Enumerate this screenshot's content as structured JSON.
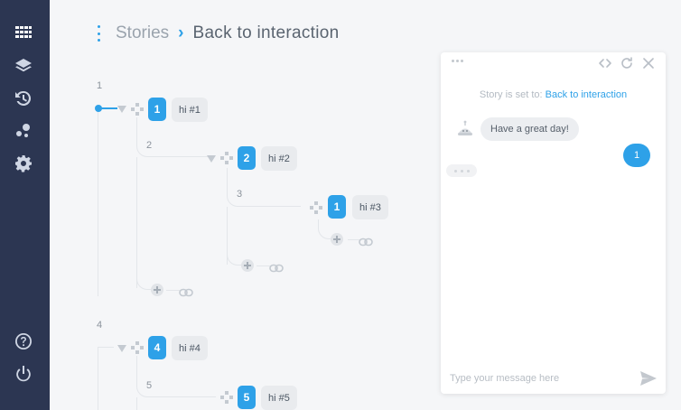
{
  "sidebar": {
    "items": [
      {
        "icon": "grid-icon"
      },
      {
        "icon": "layers-icon"
      },
      {
        "icon": "history-icon"
      },
      {
        "icon": "flows-icon"
      },
      {
        "icon": "settings-icon"
      }
    ],
    "bottom": [
      {
        "icon": "help-icon"
      },
      {
        "icon": "power-icon"
      }
    ]
  },
  "header": {
    "breadcrumb_root": "Stories",
    "separator": "›",
    "breadcrumb_current": "Back to interaction"
  },
  "tree": {
    "levels": [
      "1",
      "2",
      "3",
      "4",
      "5"
    ],
    "nodes": [
      {
        "number": "1",
        "message": "hi #1"
      },
      {
        "number": "2",
        "message": "hi #2"
      },
      {
        "number": "1",
        "message": "hi #3"
      },
      {
        "number": "4",
        "message": "hi #4"
      },
      {
        "number": "5",
        "message": "hi #5"
      }
    ]
  },
  "chat": {
    "status_prefix": "Story is set to:",
    "status_link": "Back to interaction",
    "bot_message": "Have a great day!",
    "user_message": "1",
    "input_placeholder": "Type your message here"
  },
  "colors": {
    "accent": "#2ea1e8",
    "sidebar": "#2c3652",
    "background": "#f5f6f8"
  }
}
